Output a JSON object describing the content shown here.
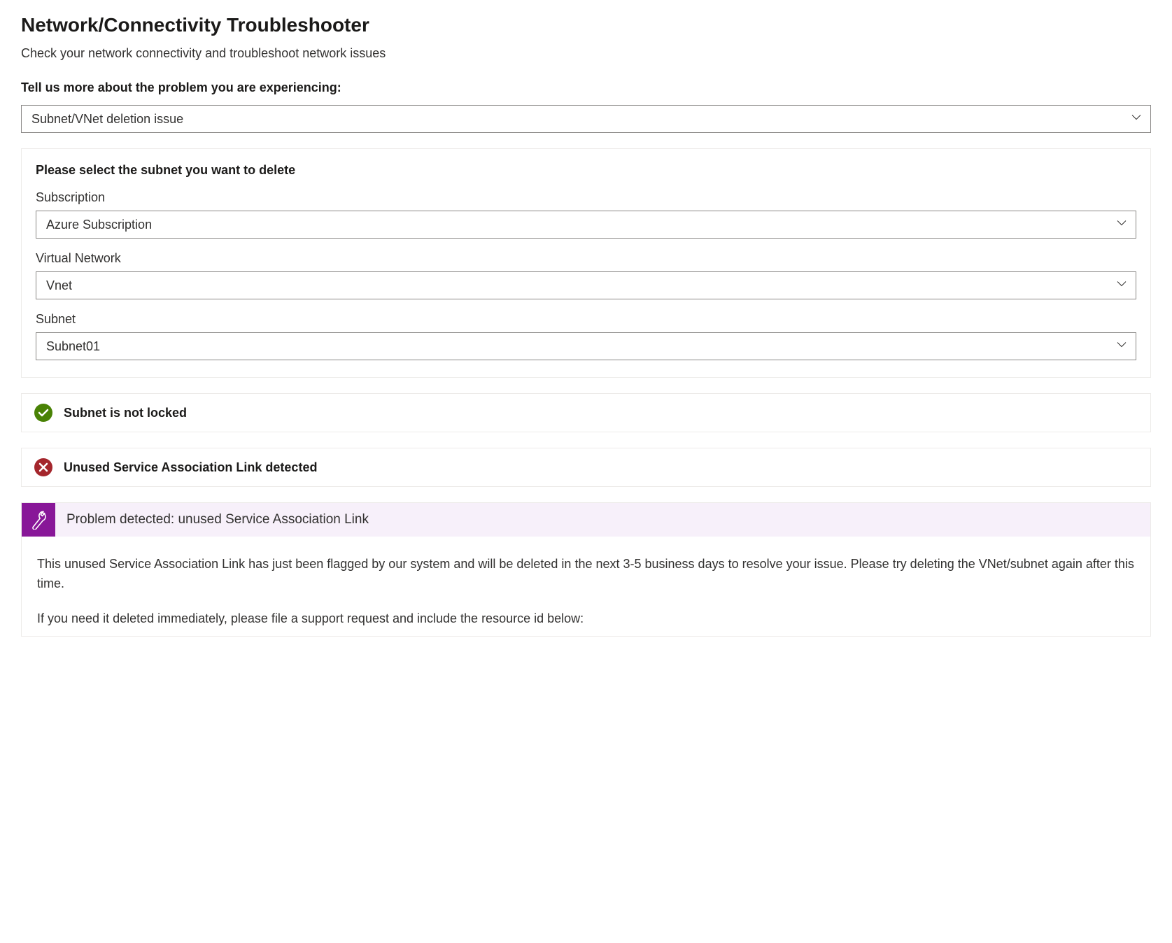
{
  "header": {
    "title": "Network/Connectivity Troubleshooter",
    "subtitle": "Check your network connectivity and troubleshoot network issues"
  },
  "problem_select": {
    "prompt": "Tell us more about the problem you are experiencing:",
    "value": "Subnet/VNet deletion issue"
  },
  "subnet_panel": {
    "title": "Please select the subnet you want to delete",
    "fields": {
      "subscription": {
        "label": "Subscription",
        "value": "Azure Subscription"
      },
      "vnet": {
        "label": "Virtual Network",
        "value": "Vnet"
      },
      "subnet": {
        "label": "Subnet",
        "value": "Subnet01"
      }
    }
  },
  "status": {
    "ok": "Subnet is not locked",
    "error": "Unused Service Association Link detected"
  },
  "problem_detail": {
    "title": "Problem detected: unused Service Association Link",
    "paragraph1": "This unused Service Association Link has just been flagged by our system and will be deleted in the next 3-5 business days to resolve your issue. Please try deleting the VNet/subnet again after this time.",
    "paragraph2": "If you need it deleted immediately, please file a support request and include the resource id below:"
  }
}
